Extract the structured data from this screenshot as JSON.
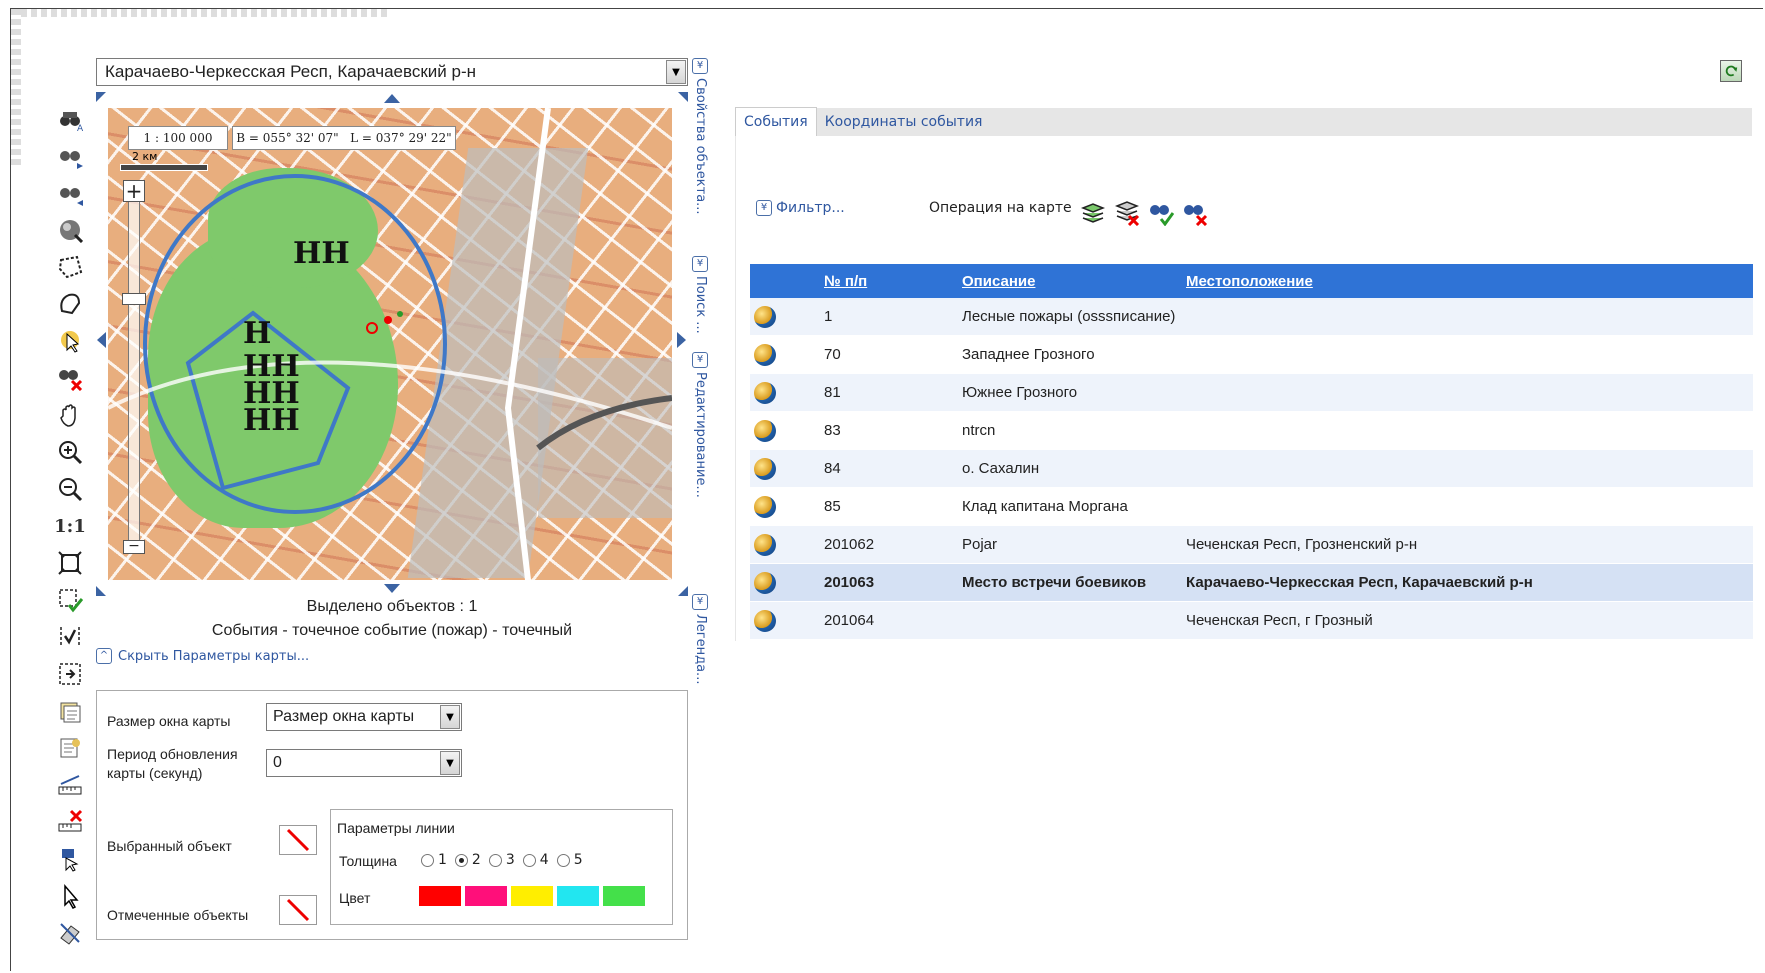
{
  "region": {
    "value": "Карачаево-Черкесская Респ, Карачаевский р-н"
  },
  "map": {
    "scale": "1 : 100 000",
    "coords": "В = 055° 32' 07\"   L = 037° 29' 22\"",
    "scalebar": "2 км"
  },
  "side_tabs": [
    {
      "label": "Свойства объекта..."
    },
    {
      "label": "Поиск ..."
    },
    {
      "label": "Редактирование..."
    },
    {
      "label": "Легенда..."
    }
  ],
  "selection": {
    "count_text": "Выделено объектов : 1",
    "layer_text": "События - точечное событие (пожар) - точечный"
  },
  "hide_params": "Скрыть Параметры карты...",
  "params": {
    "window_size_label": "Размер окна карты",
    "window_size_value": "Размер окна карты",
    "refresh_label": "Период обновления карты (секунд)",
    "refresh_value": "0",
    "selected_obj_label": "Выбранный объект",
    "marked_obj_label": "Отмеченные объекты",
    "line_params_title": "Параметры линии",
    "thickness_label": "Толщина",
    "thickness_options": [
      "1",
      "2",
      "3",
      "4",
      "5"
    ],
    "thickness_selected": "2",
    "color_label": "Цвет",
    "colors": [
      "#ff0000",
      "#ff0f7a",
      "#ffee00",
      "#22e6f0",
      "#44e04a"
    ]
  },
  "tabs": [
    {
      "label": "События",
      "active": true
    },
    {
      "label": "Координаты события",
      "active": false
    }
  ],
  "filter": {
    "label": "Фильтр..."
  },
  "operation": {
    "label": "Операция на карте"
  },
  "table": {
    "headers": [
      "№ п/п",
      "Описание",
      "Местоположение"
    ],
    "rows": [
      {
        "id": "1",
        "desc": "Лесные пожары (osssписание)",
        "loc": ""
      },
      {
        "id": "70",
        "desc": "Западнее Грозного",
        "loc": ""
      },
      {
        "id": "81",
        "desc": "Южнее Грозного",
        "loc": ""
      },
      {
        "id": "83",
        "desc": "ntrcn",
        "loc": ""
      },
      {
        "id": "84",
        "desc": "о. Сахалин",
        "loc": ""
      },
      {
        "id": "85",
        "desc": "Клад капитана Моргана",
        "loc": ""
      },
      {
        "id": "201062",
        "desc": "Pojar",
        "loc": "Чеченская Респ, Грозненский р-н"
      },
      {
        "id": "201063",
        "desc": "Место встречи боевиков",
        "loc": "Карачаево-Черкесская Респ, Карачаевский р-н",
        "selected": true
      },
      {
        "id": "201064",
        "desc": "",
        "loc": "Чеченская Респ, г Грозный"
      }
    ]
  },
  "toolbar": {
    "scale_11": "1:1"
  },
  "icons": {
    "toolbar": [
      "binoculars-a-icon",
      "binoculars-next-icon",
      "binoculars-prev-icon",
      "globe-select-icon",
      "polygon-select-icon",
      "freeform-select-icon",
      "pointer-select-icon",
      "binoculars-clear-icon",
      "hand-pan-icon",
      "zoom-in-icon",
      "zoom-out-icon",
      "scale-1-1-icon",
      "fit-extent-icon",
      "select-check-icon",
      "select-all-icon",
      "select-center-icon",
      "layers-icon",
      "layers-edit-icon",
      "ruler-icon",
      "ruler-clear-icon",
      "pin-icon",
      "arrow-icon",
      "eraser-icon"
    ]
  }
}
